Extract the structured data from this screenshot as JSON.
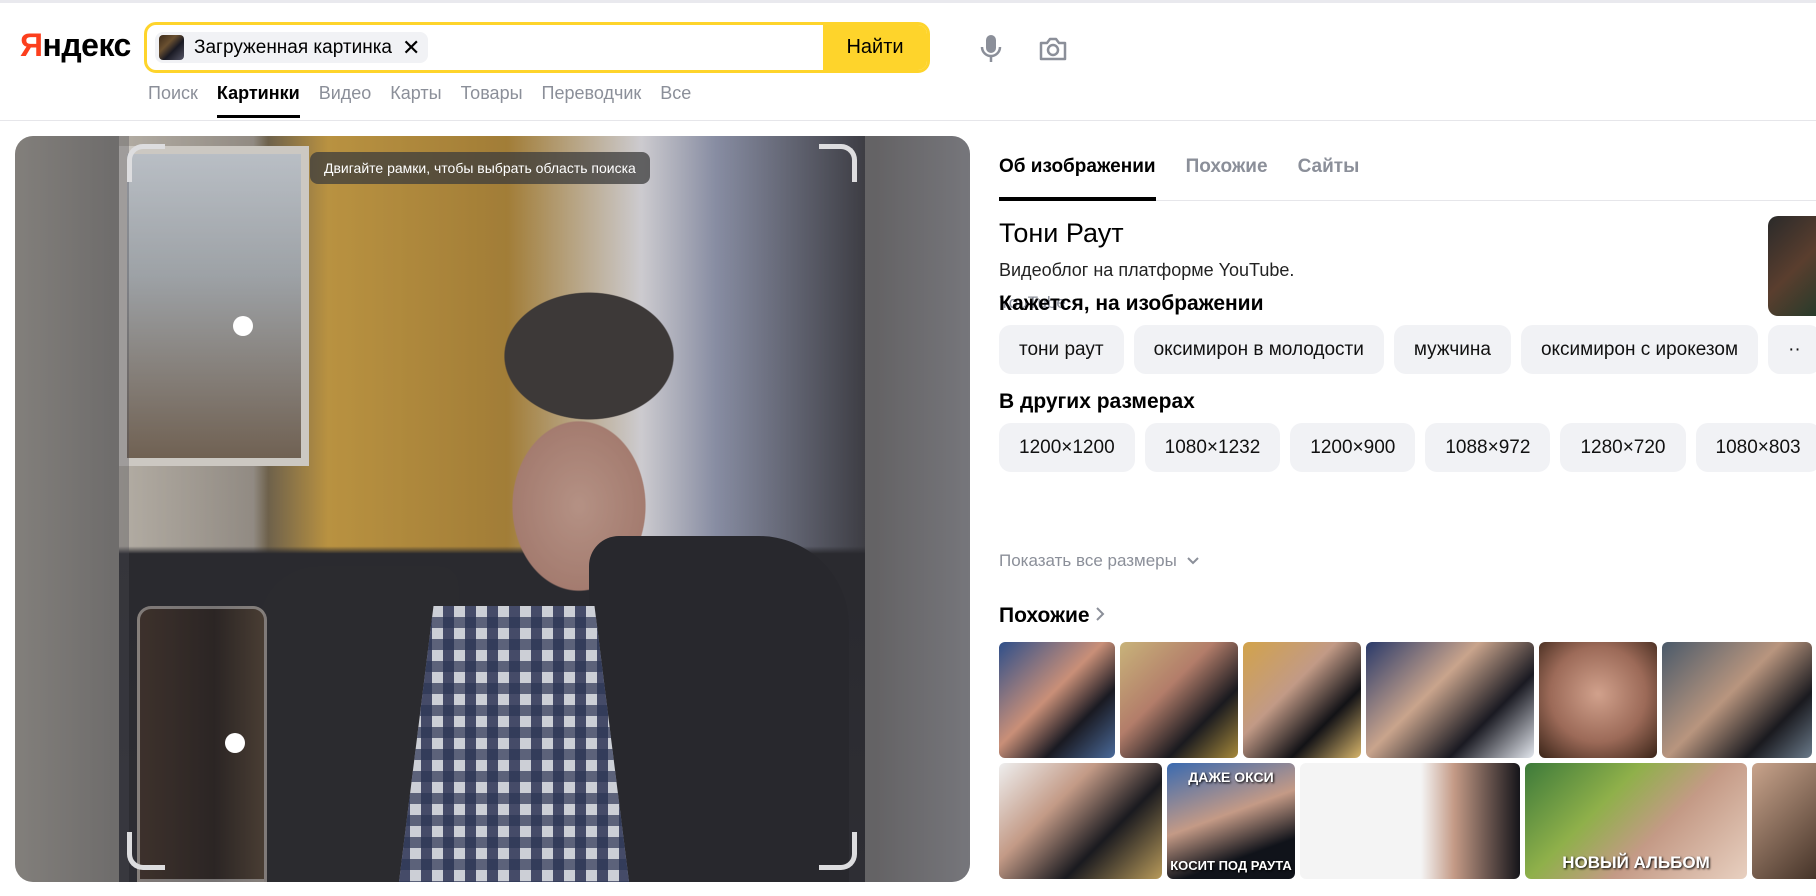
{
  "logo": {
    "first": "Я",
    "rest": "ндекс"
  },
  "search": {
    "chip_label": "Загруженная картинка",
    "chip_close": "✕",
    "value": "",
    "placeholder": "",
    "button": "Найти"
  },
  "nav": [
    "Поиск",
    "Картинки",
    "Видео",
    "Карты",
    "Товары",
    "Переводчик",
    "Все"
  ],
  "viewer": {
    "hint": "Двигайте рамки, чтобы выбрать область поиска"
  },
  "tabs": [
    "Об изображении",
    "Похожие",
    "Сайты"
  ],
  "entity": {
    "title": "Тони Раут",
    "description": "Видеоблог на платформе YouTube.",
    "source": "YouTube"
  },
  "tags_title": "Кажется, на изображении",
  "tags": [
    "тони раут",
    "оксимирон в молодости",
    "мужчина",
    "оксимирон с ирокезом"
  ],
  "sizes_title": "В других размерах",
  "sizes": [
    "1200×1200",
    "1080×1232",
    "1200×900",
    "1088×972",
    "1280×720",
    "1080×803"
  ],
  "show_all_sizes": "Показать все размеры",
  "similar_title": "Похожие",
  "similar_captions": {
    "t4": "НОВЫЙ АЛЬБОМ",
    "t2_top": "ДАЖЕ ОКСИ",
    "t2_bottom": "КОСИТ ПОД РАУТА"
  },
  "colors": {
    "accent": "#fed42b",
    "logo_red": "#fc3f1d",
    "muted": "#8b8f99"
  }
}
